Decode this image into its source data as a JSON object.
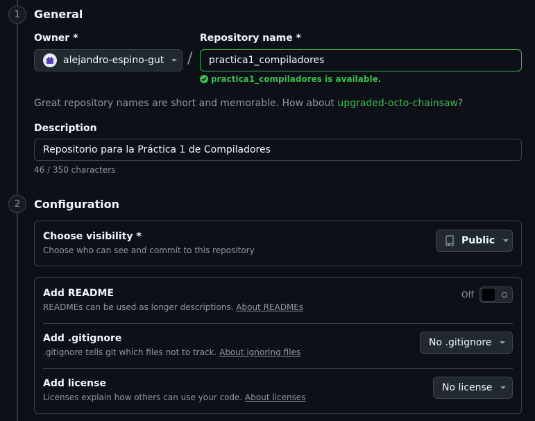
{
  "general": {
    "step": "1",
    "title": "General",
    "owner_label": "Owner *",
    "owner_value": "alejandro-espino-gut",
    "slash": "/",
    "repo_label": "Repository name *",
    "repo_value": "practica1_compiladores",
    "availability": "practica1_compiladores is available.",
    "suggestion_prefix": "Great repository names are short and memorable. How about ",
    "suggestion_link": "upgraded-octo-chainsaw",
    "suggestion_suffix": "?",
    "description_label": "Description",
    "description_value": "Repositorio para la Práctica 1 de Compiladores",
    "char_count": "46 / 350 characters"
  },
  "configuration": {
    "step": "2",
    "title": "Configuration",
    "visibility": {
      "title": "Choose visibility *",
      "desc": "Choose who can see and commit to this repository",
      "value": "Public"
    },
    "readme": {
      "title": "Add README",
      "desc": "READMEs can be used as longer descriptions. ",
      "link": "About READMEs",
      "toggle_label": "Off"
    },
    "gitignore": {
      "title": "Add .gitignore",
      "desc": ".gitignore tells git which files not to track. ",
      "link": "About ignoring files",
      "value": "No .gitignore"
    },
    "license": {
      "title": "Add license",
      "desc": "Licenses explain how others can use your code. ",
      "link": "About licenses",
      "value": "No license"
    }
  },
  "colors": {
    "background": "#0d1117",
    "accent_green": "#3fb950",
    "border": "#3d444d"
  }
}
